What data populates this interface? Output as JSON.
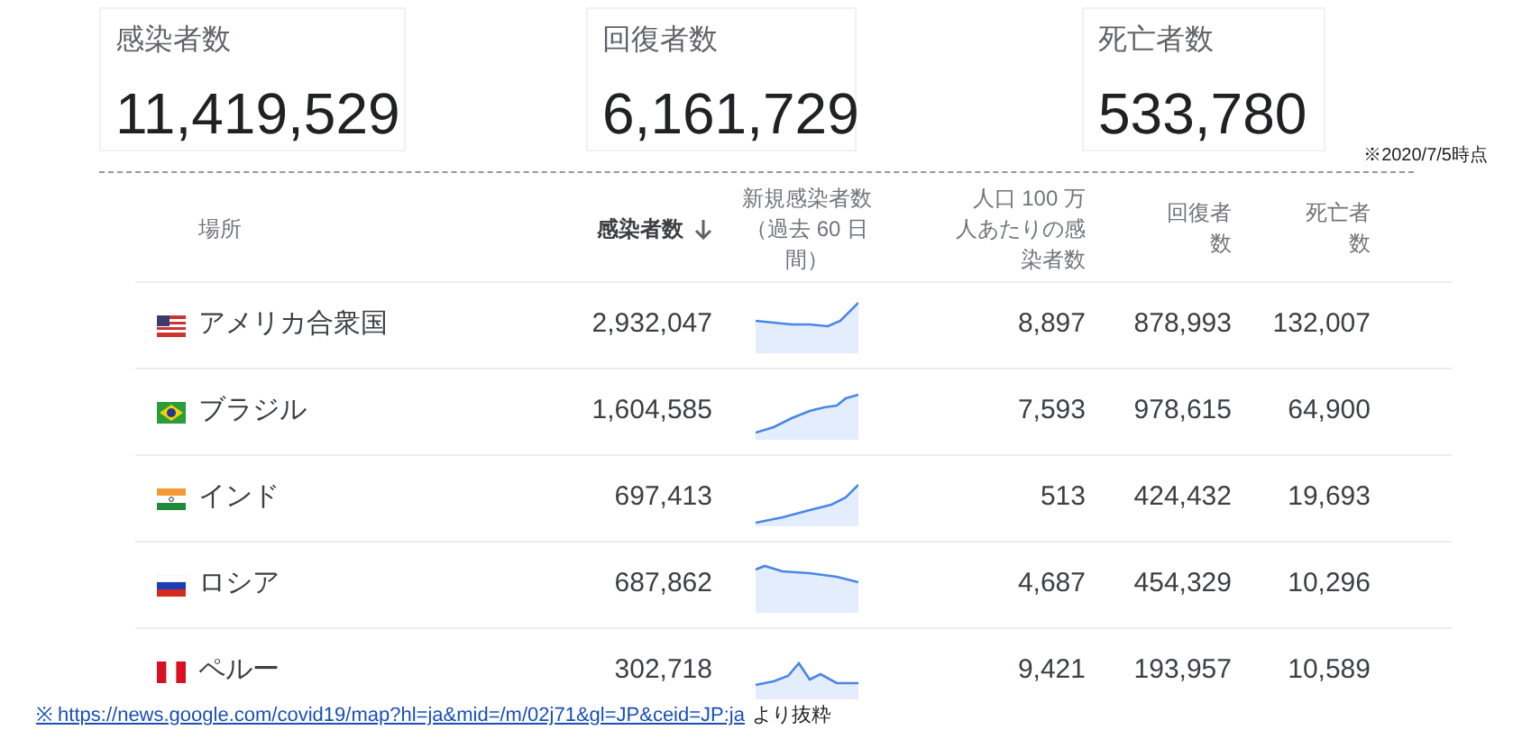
{
  "stats": [
    {
      "label": "感染者数",
      "value": "11,419,529"
    },
    {
      "label": "回復者数",
      "value": "6,161,729"
    },
    {
      "label": "死亡者数",
      "value": "533,780"
    }
  ],
  "as_of": "※2020/7/5時点",
  "table": {
    "columns": [
      {
        "label": "場所",
        "sorted": false
      },
      {
        "label": "感染者数",
        "sorted": true
      },
      {
        "label": "新規感染者数（過去 60 日間）",
        "sorted": false
      },
      {
        "label": "人口 100 万人あたりの感染者数",
        "sorted": false
      },
      {
        "label": "回復者数",
        "sorted": false
      },
      {
        "label": "死亡者数",
        "sorted": false
      }
    ],
    "rows": [
      {
        "place": "アメリカ合衆国",
        "cases": "2,932,047",
        "per_million": "8,897",
        "recovered": "878,993",
        "deaths": "132,007"
      },
      {
        "place": "ブラジル",
        "cases": "1,604,585",
        "per_million": "7,593",
        "recovered": "978,615",
        "deaths": "64,900"
      },
      {
        "place": "インド",
        "cases": "697,413",
        "per_million": "513",
        "recovered": "424,432",
        "deaths": "19,693"
      },
      {
        "place": "ロシア",
        "cases": "687,862",
        "per_million": "4,687",
        "recovered": "454,329",
        "deaths": "10,296"
      },
      {
        "place": "ペルー",
        "cases": "302,718",
        "per_million": "9,421",
        "recovered": "193,957",
        "deaths": "10,589"
      }
    ]
  },
  "source": {
    "link": "※ https://news.google.com/covid19/map?hl=ja&mid=/m/02j71&gl=JP&ceid=JP:ja",
    "suffix": "より抜粋"
  }
}
